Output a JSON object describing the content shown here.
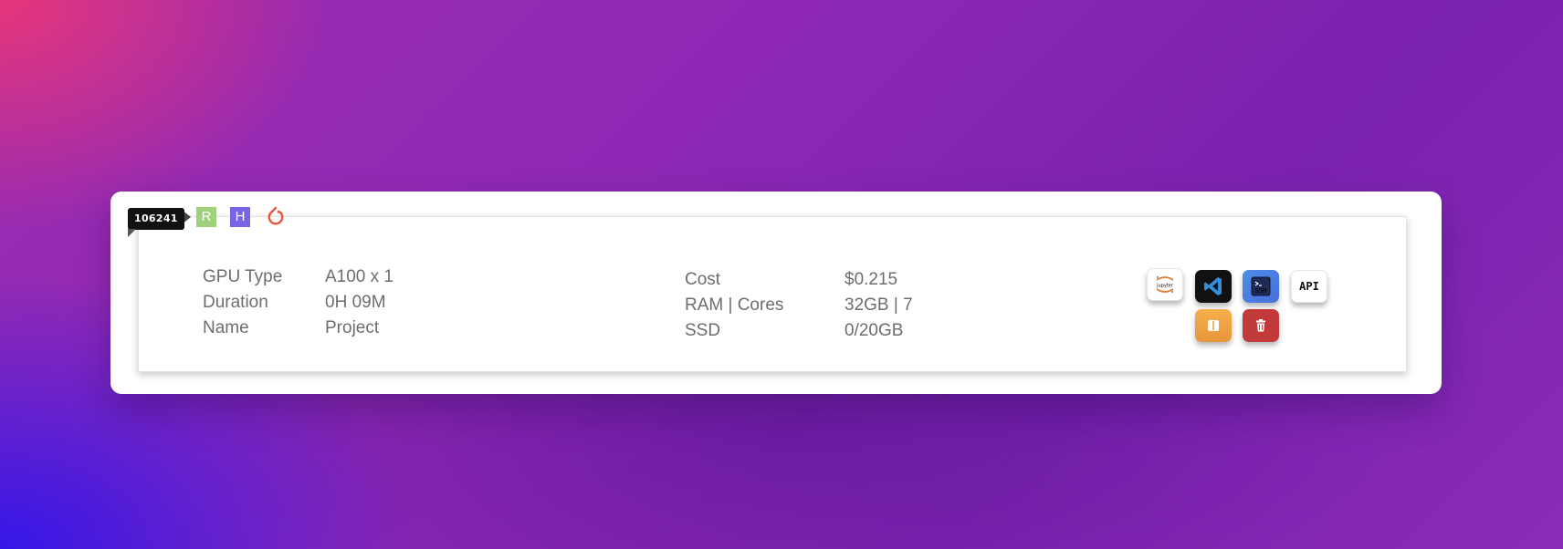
{
  "instance": {
    "id": "106241",
    "tags": [
      "R",
      "H"
    ],
    "framework_icon": "pytorch-icon",
    "details_left": [
      {
        "label": "GPU Type",
        "value": "A100 x 1"
      },
      {
        "label": "Duration",
        "value": "0H 09M"
      },
      {
        "label": "Name",
        "value": "Project"
      }
    ],
    "details_right": [
      {
        "label": "Cost",
        "value": "$0.215"
      },
      {
        "label": "RAM | Cores",
        "value": "32GB | 7"
      },
      {
        "label": "SSD",
        "value": "0/20GB"
      }
    ]
  },
  "actions": {
    "jupyter": {
      "icon": "jupyter-icon",
      "text": "jupyter"
    },
    "vscode": {
      "icon": "vscode-icon"
    },
    "ssh": {
      "icon": "terminal-icon",
      "text": "SSH"
    },
    "api": {
      "text": "API"
    },
    "pause": {
      "icon": "pause-icon"
    },
    "delete": {
      "icon": "trash-icon"
    }
  },
  "colors": {
    "tag_r": "#9fd07a",
    "tag_h": "#7b63e6",
    "pause": "#f0a444",
    "delete": "#c23a3a",
    "ssh": "#4a7ee2"
  }
}
